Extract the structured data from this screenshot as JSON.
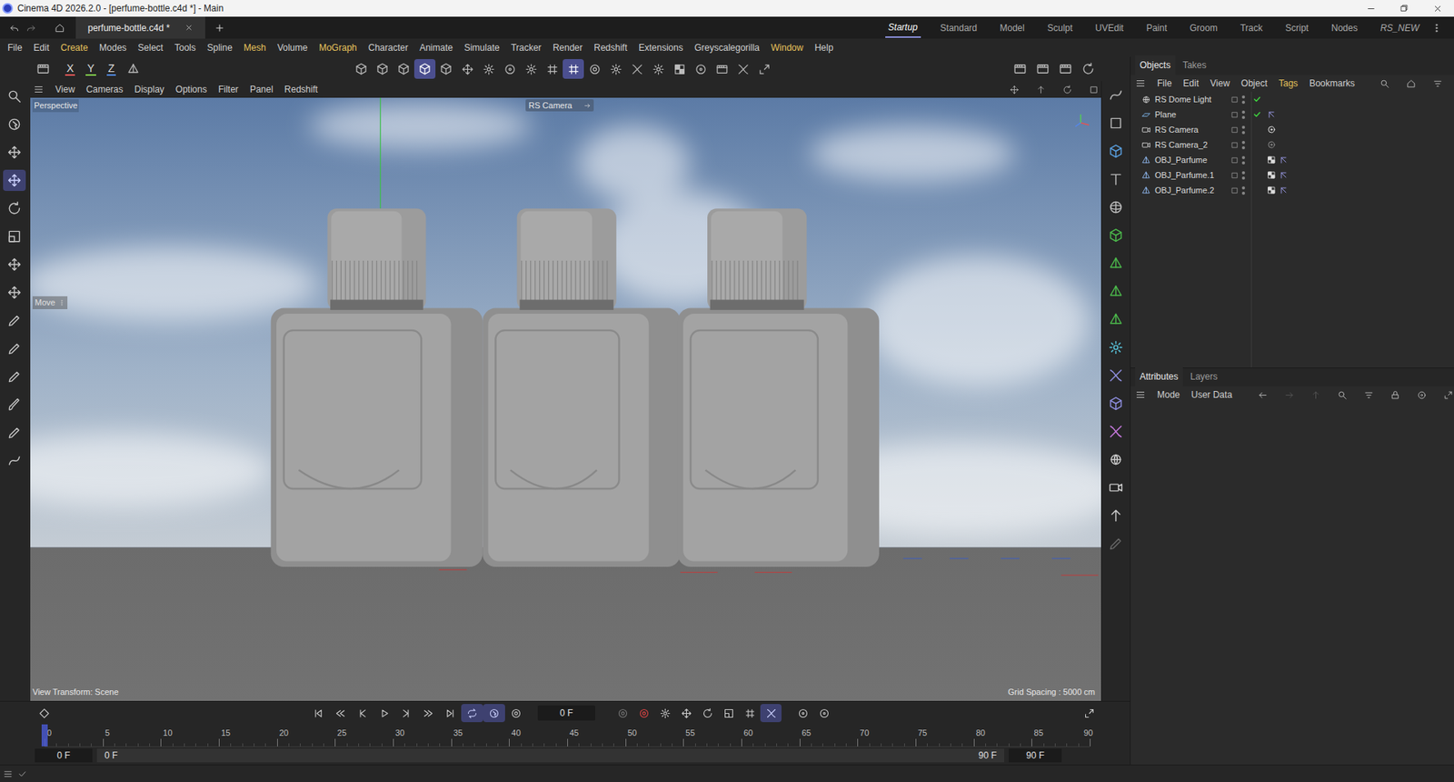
{
  "window": {
    "title": "Cinema 4D 2026.2.0 - [perfume-bottle.c4d *] - Main"
  },
  "document_tabs": [
    {
      "label": "perfume-bottle.c4d *",
      "selected": true
    }
  ],
  "layouts": [
    {
      "label": "Startup",
      "selected": true
    },
    {
      "label": "Standard",
      "selected": false
    },
    {
      "label": "Model",
      "selected": false
    },
    {
      "label": "Sculpt",
      "selected": false
    },
    {
      "label": "UVEdit",
      "selected": false
    },
    {
      "label": "Paint",
      "selected": false
    },
    {
      "label": "Groom",
      "selected": false
    },
    {
      "label": "Track",
      "selected": false
    },
    {
      "label": "Script",
      "selected": false
    },
    {
      "label": "Nodes",
      "selected": false
    },
    {
      "label": "RS_NEW",
      "selected": false
    }
  ],
  "menu": [
    {
      "label": "File",
      "highlight": false
    },
    {
      "label": "Edit",
      "highlight": false
    },
    {
      "label": "Create",
      "highlight": true
    },
    {
      "label": "Modes",
      "highlight": false
    },
    {
      "label": "Select",
      "highlight": false
    },
    {
      "label": "Tools",
      "highlight": false
    },
    {
      "label": "Spline",
      "highlight": false
    },
    {
      "label": "Mesh",
      "highlight": true
    },
    {
      "label": "Volume",
      "highlight": false
    },
    {
      "label": "MoGraph",
      "highlight": true
    },
    {
      "label": "Character",
      "highlight": false
    },
    {
      "label": "Animate",
      "highlight": false
    },
    {
      "label": "Simulate",
      "highlight": false
    },
    {
      "label": "Tracker",
      "highlight": false
    },
    {
      "label": "Render",
      "highlight": false
    },
    {
      "label": "Redshift",
      "highlight": false
    },
    {
      "label": "Extensions",
      "highlight": false
    },
    {
      "label": "Greyscalegorilla",
      "highlight": false
    },
    {
      "label": "Window",
      "highlight": true
    },
    {
      "label": "Help",
      "highlight": false
    }
  ],
  "toolbar": {
    "axis_locks": [
      {
        "label": "X",
        "color": "#e05555"
      },
      {
        "label": "Y",
        "color": "#7fc84a"
      },
      {
        "label": "Z",
        "color": "#4f86e0"
      }
    ]
  },
  "viewport": {
    "menu": [
      "View",
      "Cameras",
      "Display",
      "Options",
      "Filter",
      "Panel",
      "Redshift"
    ],
    "label": "Perspective",
    "camera": "RS Camera",
    "tool": "Move",
    "view_transform": "View Transform: Scene",
    "grid_spacing": "Grid Spacing : 5000 cm"
  },
  "objects_panel": {
    "tabs": [
      {
        "label": "Objects",
        "selected": true
      },
      {
        "label": "Takes",
        "selected": false
      }
    ],
    "menu": [
      {
        "label": "File",
        "highlight": false
      },
      {
        "label": "Edit",
        "highlight": false
      },
      {
        "label": "View",
        "highlight": false
      },
      {
        "label": "Object",
        "highlight": false
      },
      {
        "label": "Tags",
        "highlight": true
      },
      {
        "label": "Bookmarks",
        "highlight": false
      }
    ],
    "items": [
      {
        "name": "RS Dome Light",
        "kind": "light",
        "enabled": true
      },
      {
        "name": "Plane",
        "kind": "plane",
        "enabled": true
      },
      {
        "name": "RS Camera",
        "kind": "camera",
        "enabled": false
      },
      {
        "name": "RS Camera_2",
        "kind": "camera",
        "enabled": false
      },
      {
        "name": "OBJ_Parfume",
        "kind": "mesh",
        "enabled": false
      },
      {
        "name": "OBJ_Parfume.1",
        "kind": "mesh",
        "enabled": false
      },
      {
        "name": "OBJ_Parfume.2",
        "kind": "mesh",
        "enabled": false
      }
    ]
  },
  "attributes_panel": {
    "tabs": [
      {
        "label": "Attributes",
        "selected": true
      },
      {
        "label": "Layers",
        "selected": false
      }
    ],
    "menu": [
      "Mode",
      "User Data"
    ]
  },
  "timeline": {
    "current_frame": "0 F",
    "ticks": [
      "0",
      "5",
      "10",
      "15",
      "20",
      "25",
      "30",
      "35",
      "40",
      "45",
      "50",
      "55",
      "60",
      "65",
      "70",
      "75",
      "80",
      "85",
      "90"
    ],
    "playhead": 0,
    "start": "0 F",
    "preview_start": "0 F",
    "preview_end": "90 F",
    "end": "90 F"
  }
}
